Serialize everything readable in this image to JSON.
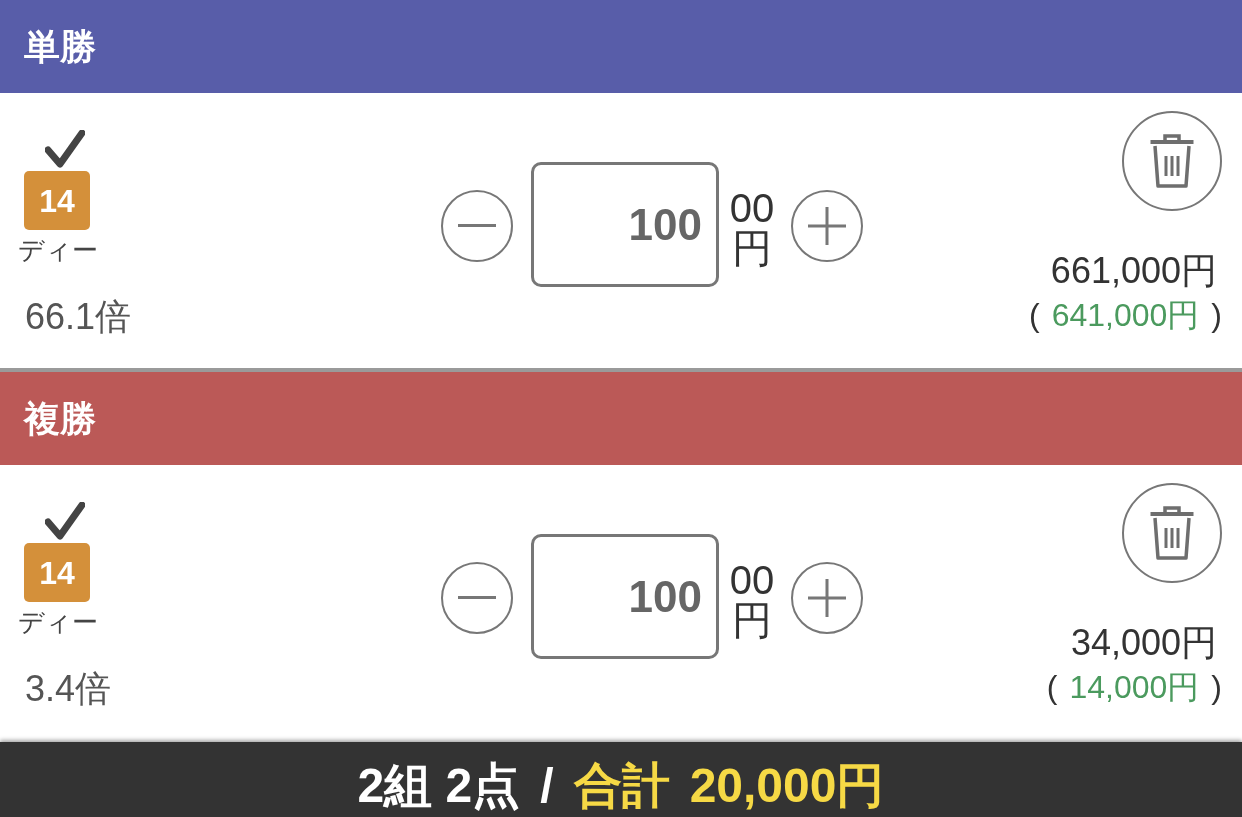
{
  "sections": [
    {
      "title": "単勝",
      "color": "#585da9",
      "entries": [
        {
          "checked": true,
          "number": "14",
          "name": "ディー",
          "odds": "66.1倍",
          "amount": "100",
          "unit": "00円",
          "payout": "661,000円",
          "profit_open": "(",
          "profit": "641,000円",
          "profit_close": ")"
        }
      ]
    },
    {
      "title": "複勝",
      "color": "#bb5957",
      "entries": [
        {
          "checked": true,
          "number": "14",
          "name": "ディー",
          "odds": "3.4倍",
          "amount": "100",
          "unit": "00円",
          "payout": "34,000円",
          "profit_open": "(",
          "profit": "14,000円",
          "profit_close": ")"
        }
      ]
    }
  ],
  "footer": {
    "count": "2組 2点",
    "separator": "/",
    "total_label": "合計",
    "total": "20,000円"
  }
}
